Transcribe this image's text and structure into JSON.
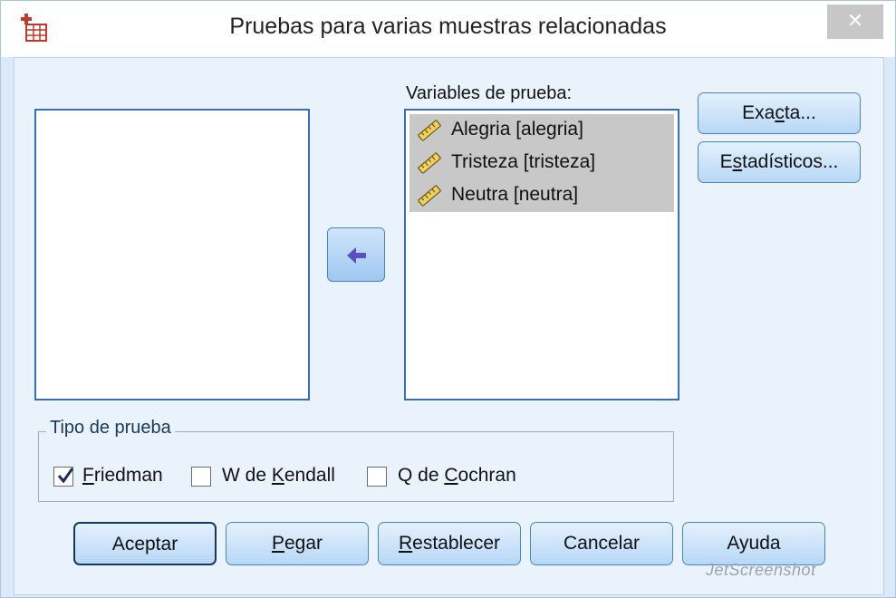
{
  "window": {
    "title": "Pruebas para varias muestras relacionadas",
    "close_glyph": "✕"
  },
  "target_list": {
    "label": "Variables de prueba:",
    "items": [
      {
        "label": "Alegria [alegria]",
        "icon": "ruler-scale-icon"
      },
      {
        "label": "Tristeza [tristeza]",
        "icon": "ruler-scale-icon"
      },
      {
        "label": "Neutra [neutra]",
        "icon": "ruler-scale-icon"
      }
    ]
  },
  "side_buttons": {
    "exact": {
      "pre": "Exa",
      "ul": "c",
      "post": "ta..."
    },
    "stats": {
      "pre": "E",
      "ul": "s",
      "post": "tadísticos..."
    }
  },
  "test_type": {
    "label": "Tipo de prueba",
    "friedman": {
      "pre": "",
      "ul": "F",
      "post": "riedman",
      "checked": true
    },
    "kendall": {
      "pre": "W de ",
      "ul": "K",
      "post": "endall",
      "checked": false
    },
    "cochran": {
      "pre": "Q de ",
      "ul": "C",
      "post": "ochran",
      "checked": false
    }
  },
  "bottom_buttons": {
    "ok": {
      "pre": "Aceptar",
      "ul": "",
      "post": ""
    },
    "paste": {
      "pre": "",
      "ul": "P",
      "post": "egar"
    },
    "reset": {
      "pre": "",
      "ul": "R",
      "post": "establecer"
    },
    "cancel": {
      "pre": "Cancelar",
      "ul": "",
      "post": ""
    },
    "help": {
      "pre": "Ayuda",
      "ul": "",
      "post": ""
    }
  },
  "watermark": "JetScreenshot",
  "colors": {
    "accent": "#3a6eb3",
    "selected_item": "#c8c8c8",
    "button_top": "#e4f1fd",
    "button_bottom": "#b7d7f6"
  }
}
